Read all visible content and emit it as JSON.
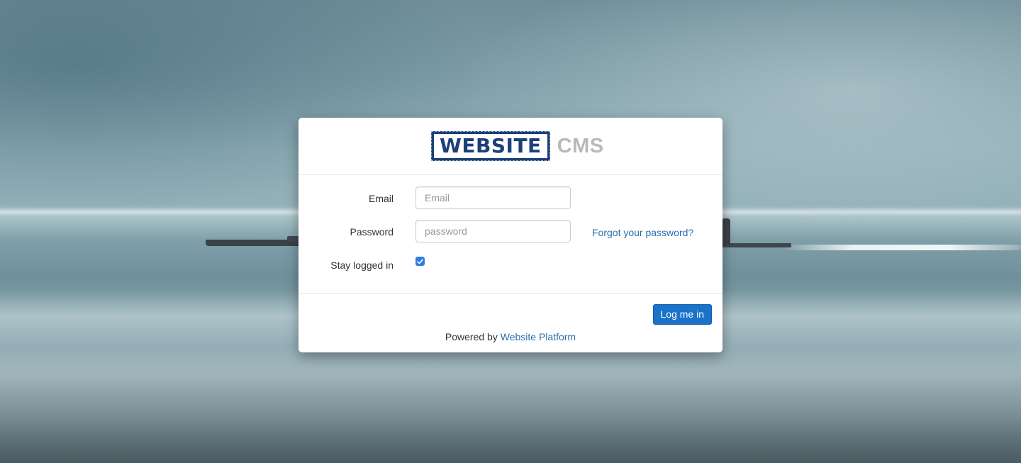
{
  "logo": {
    "brand": "WEBSITE",
    "product": "CMS"
  },
  "form": {
    "email": {
      "label": "Email",
      "placeholder": "Email",
      "value": ""
    },
    "password": {
      "label": "Password",
      "placeholder": "password",
      "value": ""
    },
    "stay_logged_in": {
      "label": "Stay logged in",
      "checked": true
    },
    "forgot_password_link": "Forgot your password?"
  },
  "footer": {
    "login_button": "Log me in",
    "powered_by_prefix": "Powered by",
    "powered_by_link": "Website Platform"
  },
  "colors": {
    "primary": "#1a73c9",
    "link": "#2a6fb0",
    "logo_blue": "#1d3f7a",
    "logo_gray": "#b9b9b9"
  }
}
